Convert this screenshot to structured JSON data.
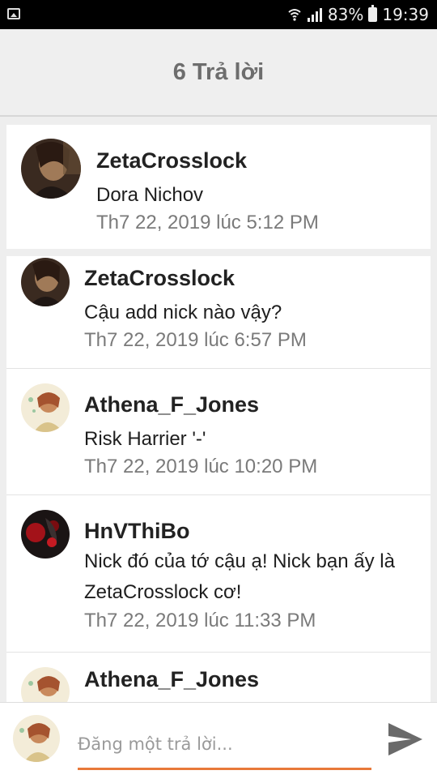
{
  "status_bar": {
    "battery": "83%",
    "time": "19:39"
  },
  "header": {
    "title": "6 Trả lời"
  },
  "post": {
    "author": "ZetaCrosslock",
    "text": "Dora Nichov",
    "date": "Th7 22, 2019 lúc 5:12 PM"
  },
  "replies": [
    {
      "author": "ZetaCrosslock",
      "text": "Cậu add nick nào vậy?",
      "date": "Th7 22, 2019 lúc 6:57 PM"
    },
    {
      "author": "Athena_F_Jones",
      "text": "Risk Harrier '-'",
      "date": "Th7 22, 2019 lúc 10:20 PM"
    },
    {
      "author": "HnVThiBo",
      "text_line1": "Nick đó của tớ cậu ạ! Nick bạn ấy là",
      "text_line2": "ZetaCrosslock cơ!",
      "date": "Th7 22, 2019 lúc 11:33 PM"
    },
    {
      "author": "Athena_F_Jones"
    }
  ],
  "composer": {
    "placeholder": "Đăng một trả lời..."
  },
  "colors": {
    "accent": "#e8793a",
    "header_bg": "#efefef",
    "title": "#6d6d6d"
  },
  "icons": {
    "send": "send-icon",
    "gallery": "image-icon"
  }
}
